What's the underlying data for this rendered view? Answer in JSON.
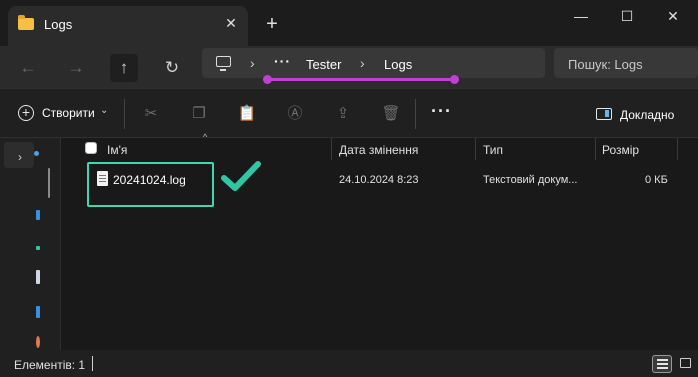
{
  "window": {
    "tab_title": "Logs",
    "tab_close": "✕",
    "new_tab": "+",
    "minimize": "—",
    "maximize": "☐",
    "close": "✕"
  },
  "nav": {
    "back": "←",
    "forward": "→",
    "up": "↑",
    "refresh": "↻",
    "breadcrumb_overflow": "···",
    "breadcrumb_sep": "›",
    "breadcrumbs": [
      "Tester",
      "Logs"
    ],
    "search_placeholder": "Пошук: Logs"
  },
  "toolbar": {
    "create_label": "Створити",
    "create_chevron": "⌄",
    "more": "···",
    "details_label": "Докладно"
  },
  "columns": {
    "name": "Ім'я",
    "date": "Дата змінення",
    "type": "Тип",
    "size": "Розмір",
    "sort_indicator": "^"
  },
  "files": [
    {
      "name": "20241024.log",
      "date": "24.10.2024 8:23",
      "type": "Текстовий докум...",
      "size": "0 КБ"
    }
  ],
  "status": {
    "items_label": "Елементів: 1"
  },
  "colors": {
    "highlight_box": "#3fd6b1",
    "checkmark": "#2fc7a3",
    "annotation_underline": "#c23fd6"
  }
}
